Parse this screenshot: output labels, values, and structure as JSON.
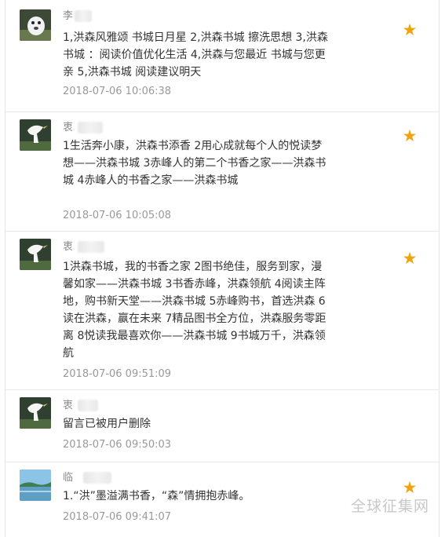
{
  "comments": [
    {
      "name": "李",
      "text": "1,洪森风雅颂 书城日月星 2,洪森书城 擦洗思想 3,洪森书城 ：阅读价值优化生活 4,洪森与您最近 书城与您更亲 5,洪森书城 阅读建议明天",
      "time": "2018-07-06 10:06:38",
      "starred": true,
      "avatar": "dog-avatar"
    },
    {
      "name": "衷",
      "text": "1生活奔小康，洪森书添香 2用心成就每个人的悦读梦想——洪森书城 3赤峰人的第二个书香之家——洪森书城 4赤峰人的书香之家——洪森书城",
      "time": "2018-07-06 10:05:08",
      "starred": true,
      "avatar": "egret-avatar"
    },
    {
      "name": "衷",
      "text": "1洪森书城，我的书香之家 2图书绝佳，服务到家，漫馨如家——洪森书城 3书香赤峰，洪森领航 4阅读主阵地，购书新天堂——洪森书城 5赤峰购书，首选洪森 6读在洪森，赢在未来 7精品图书全方位，洪森服务零距离 8悦读我最喜欢你——洪森书城 9书城万千，洪森领航",
      "time": "2018-07-06 09:51:09",
      "starred": true,
      "avatar": "egret-avatar"
    },
    {
      "name": "衷",
      "text": "留言已被用户删除",
      "time": "2018-07-06 09:50:03",
      "starred": false,
      "avatar": "egret-avatar"
    },
    {
      "name": "临",
      "text": "1.“洪”墨溢满书香，“森”情拥抱赤峰。",
      "time": "2018-07-06 09:41:07",
      "starred": true,
      "avatar": "landscape-avatar"
    }
  ],
  "watermark": "全球征集网",
  "colors": {
    "star": "#f0a30a",
    "text": "#333333",
    "time": "#999999"
  }
}
